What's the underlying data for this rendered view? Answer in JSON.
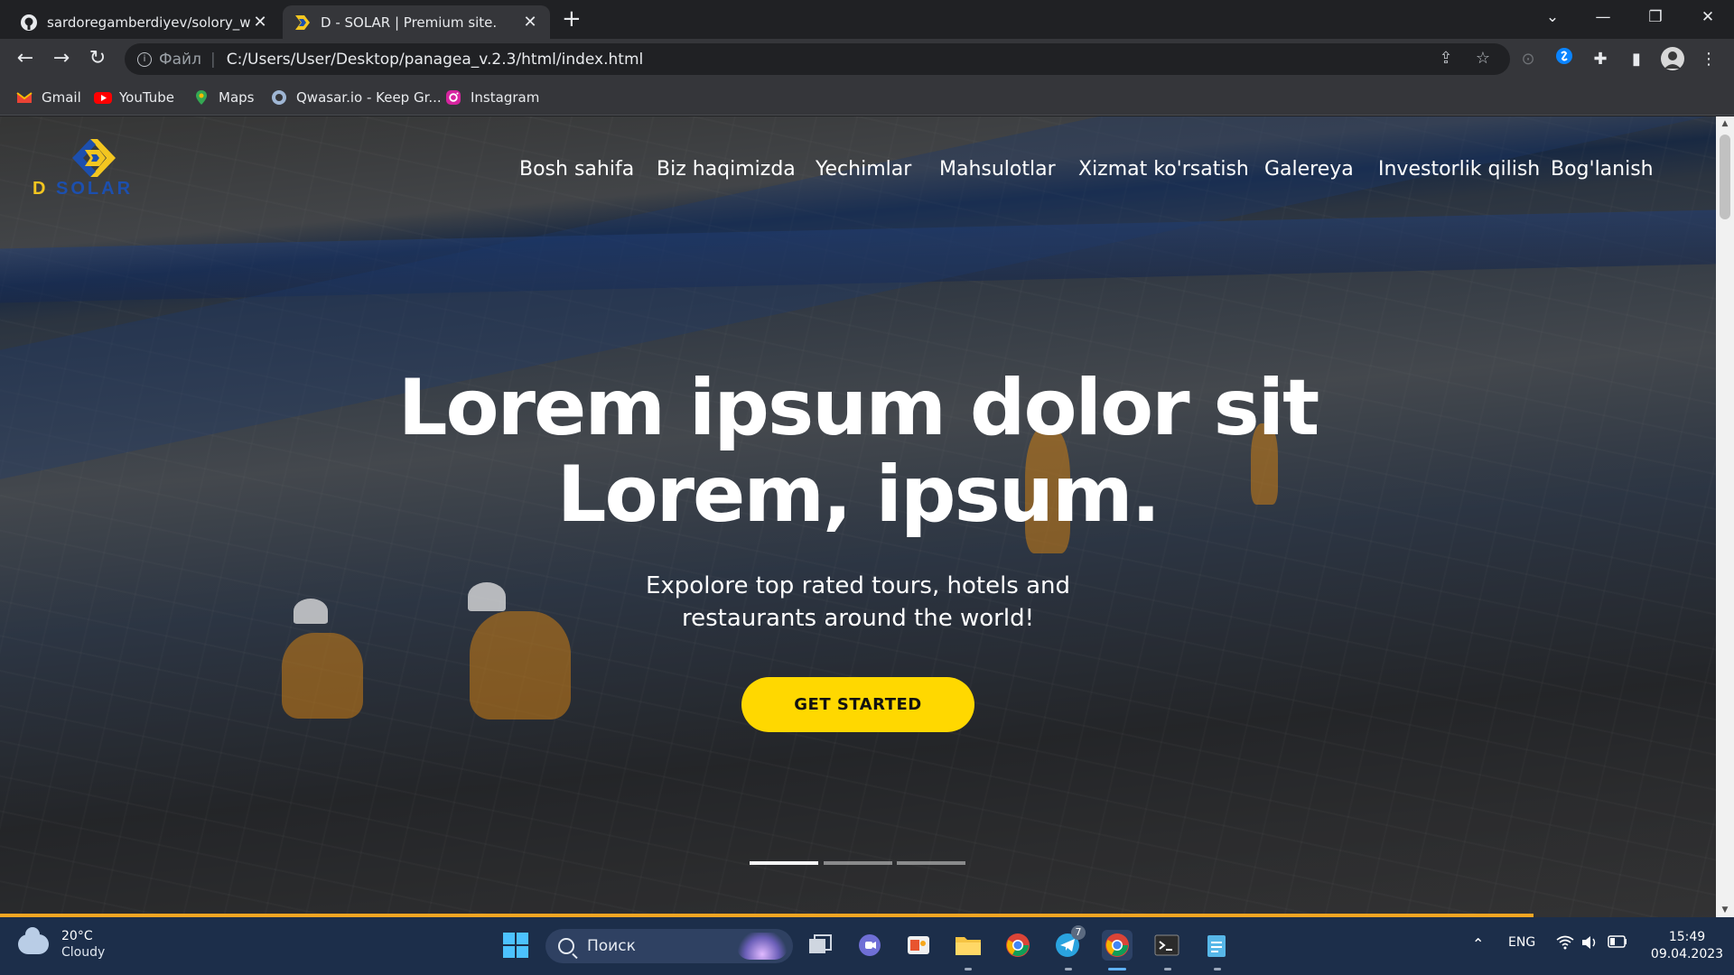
{
  "browser": {
    "tabs": [
      {
        "title": "sardoregamberdiyev/solory_web",
        "active": false
      },
      {
        "title": "D - SOLAR | Premium site.",
        "active": true
      }
    ],
    "new_tab": "+",
    "address": {
      "scheme_label": "Файл",
      "separator": "|",
      "url": "C:/Users/User/Desktop/panagea_v.2.3/html/index.html"
    },
    "bookmarks": [
      {
        "label": "Gmail",
        "color": "#ea4335"
      },
      {
        "label": "YouTube",
        "color": "#ff0000"
      },
      {
        "label": "Maps",
        "color": "#34a853"
      },
      {
        "label": "Qwasar.io - Keep Gr...",
        "color": "#9fb6d4"
      },
      {
        "label": "Instagram",
        "color": "#d6249f"
      }
    ]
  },
  "site": {
    "logo": {
      "letter": "D",
      "word": "SOLAR"
    },
    "nav": [
      "Bosh sahifa",
      "Biz haqimizda",
      "Yechimlar",
      "Mahsulotlar",
      "Xizmat ko'rsatish",
      "Galereya",
      "Investorlik qilish",
      "Bog'lanish"
    ],
    "hero": {
      "title_line1": "Lorem ipsum dolor sit",
      "title_line2": "Lorem, ipsum.",
      "subtitle_line1": "Expolore top rated tours, hotels and",
      "subtitle_line2": "restaurants around the world!",
      "cta": "GET STARTED",
      "slides": 3,
      "active_slide": 0,
      "accent": "#ffd800"
    }
  },
  "taskbar": {
    "weather": {
      "temp": "20°C",
      "condition": "Cloudy"
    },
    "search_placeholder": "Поиск",
    "telegram_badge": "7",
    "language": "ENG",
    "time": "15:49",
    "date": "09.04.2023"
  }
}
